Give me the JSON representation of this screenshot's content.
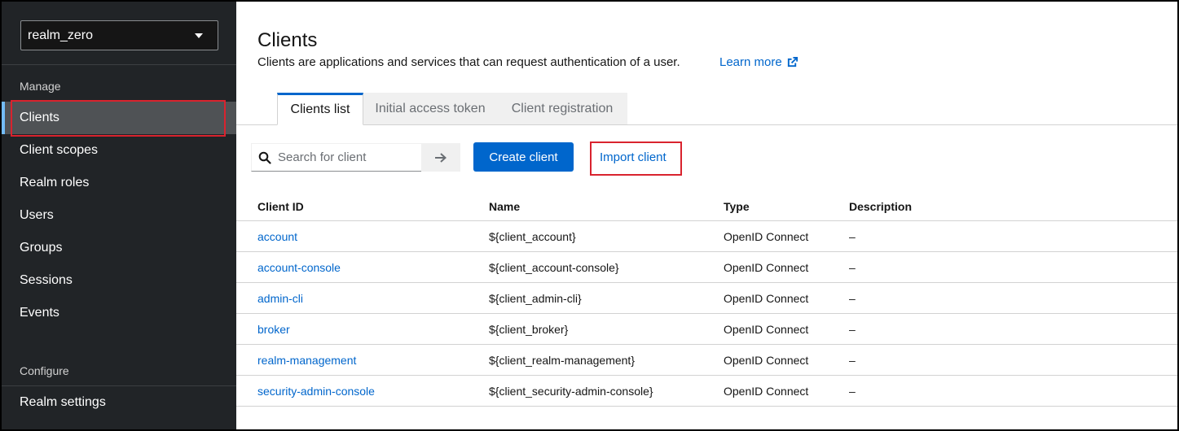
{
  "realm": {
    "name": "realm_zero"
  },
  "sidebar": {
    "manage_title": "Manage",
    "manage_items": [
      {
        "label": "Clients",
        "active": true
      },
      {
        "label": "Client scopes"
      },
      {
        "label": "Realm roles"
      },
      {
        "label": "Users"
      },
      {
        "label": "Groups"
      },
      {
        "label": "Sessions"
      },
      {
        "label": "Events"
      }
    ],
    "configure_title": "Configure",
    "configure_items": [
      {
        "label": "Realm settings"
      }
    ]
  },
  "page": {
    "title": "Clients",
    "description": "Clients are applications and services that can request authentication of a user.",
    "learn_more": "Learn more"
  },
  "tabs": [
    {
      "label": "Clients list",
      "active": true
    },
    {
      "label": "Initial access token"
    },
    {
      "label": "Client registration"
    }
  ],
  "toolbar": {
    "search_placeholder": "Search for client",
    "create_label": "Create client",
    "import_label": "Import client"
  },
  "table": {
    "headers": [
      "Client ID",
      "Name",
      "Type",
      "Description"
    ],
    "rows": [
      {
        "client_id": "account",
        "name": "${client_account}",
        "type": "OpenID Connect",
        "description": "–"
      },
      {
        "client_id": "account-console",
        "name": "${client_account-console}",
        "type": "OpenID Connect",
        "description": "–"
      },
      {
        "client_id": "admin-cli",
        "name": "${client_admin-cli}",
        "type": "OpenID Connect",
        "description": "–"
      },
      {
        "client_id": "broker",
        "name": "${client_broker}",
        "type": "OpenID Connect",
        "description": "–"
      },
      {
        "client_id": "realm-management",
        "name": "${client_realm-management}",
        "type": "OpenID Connect",
        "description": "–"
      },
      {
        "client_id": "security-admin-console",
        "name": "${client_security-admin-console}",
        "type": "OpenID Connect",
        "description": "–"
      }
    ]
  },
  "colors": {
    "accent": "#0066cc",
    "sidebar_bg": "#212427",
    "highlight": "#d9232e"
  }
}
